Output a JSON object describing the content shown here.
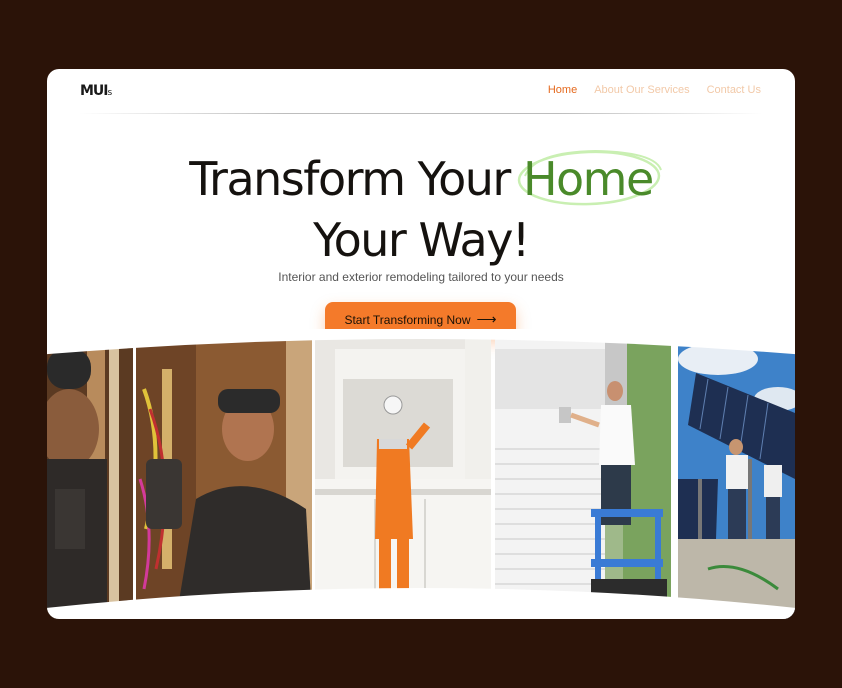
{
  "logo": {
    "main": "MUI",
    "suffix": "s"
  },
  "nav": {
    "home": "Home",
    "services": "About Our Services",
    "contact": "Contact Us"
  },
  "hero": {
    "title_part1": "Transform Your ",
    "title_highlight": "Home",
    "title_line2": "Your Way!",
    "subtitle": "Interior and exterior remodeling tailored to your needs",
    "cta_label": "Start Transforming Now",
    "cta_icon": "arrow-right-icon"
  },
  "colors": {
    "background": "#2b1308",
    "accent": "#f47a2a",
    "highlight": "#4a8a2a",
    "highlight_ring": "#c9efb2"
  },
  "gallery": [
    {
      "subject": "electrician-closeup"
    },
    {
      "subject": "electrician-wiring"
    },
    {
      "subject": "kitchen-worker"
    },
    {
      "subject": "siding-painter"
    },
    {
      "subject": "solar-installers"
    }
  ]
}
